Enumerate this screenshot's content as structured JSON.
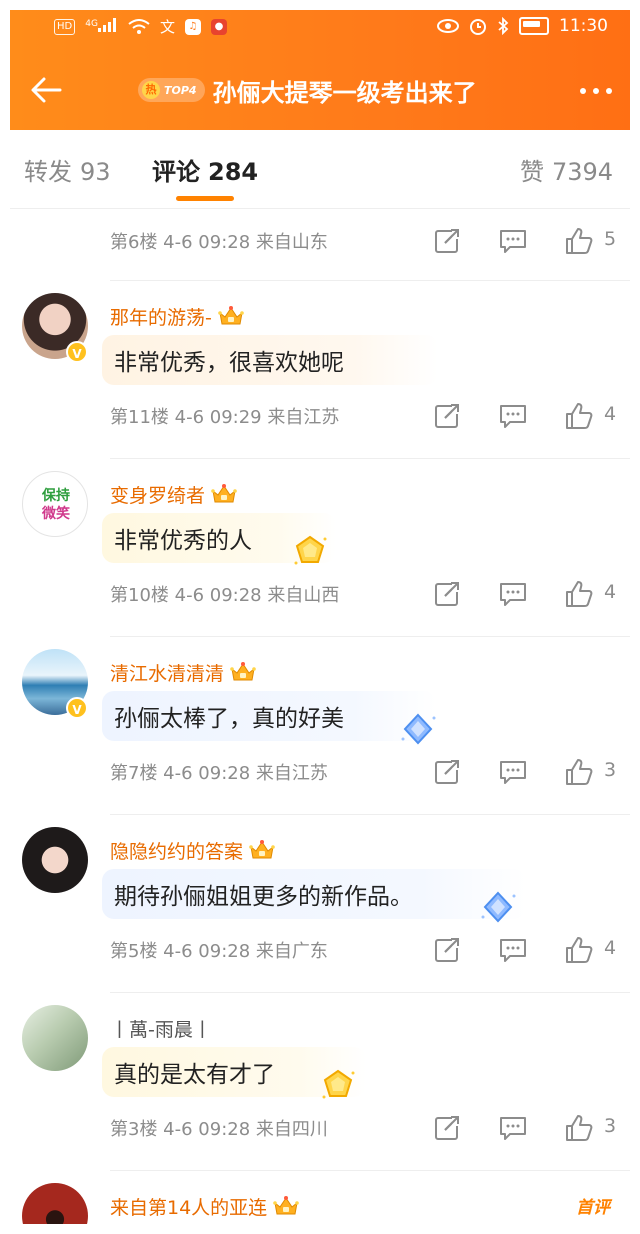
{
  "status_bar": {
    "hd": "HD",
    "net": "4G",
    "time": "11:30"
  },
  "header": {
    "hot_char": "热",
    "hot_rank": "TOP4",
    "title": "孙俪大提琴一级考出来了"
  },
  "tabs": [
    {
      "label": "转发",
      "count": "93"
    },
    {
      "label": "评论",
      "count": "284"
    },
    {
      "label": "赞",
      "count": "7394"
    }
  ],
  "first_row": {
    "meta": "第6楼 4-6 09:28 来自山东",
    "likes": "5"
  },
  "comments": [
    {
      "user": "那年的游荡-",
      "text": "非常优秀，很喜欢她呢",
      "meta": "第11楼 4-6 09:29 来自江苏",
      "likes": "4"
    },
    {
      "user": "变身罗绮者",
      "text": "非常优秀的人",
      "meta": "第10楼 4-6 09:28 来自山西",
      "likes": "4",
      "avatar_text": [
        "保持",
        "微笑"
      ]
    },
    {
      "user": "清江水清清清",
      "text": "孙俪太棒了，真的好美",
      "meta": "第7楼 4-6 09:28 来自江苏",
      "likes": "3"
    },
    {
      "user": "隐隐约约的答案",
      "text": "期待孙俪姐姐更多的新作品。",
      "meta": "第5楼 4-6 09:28 来自广东",
      "likes": "4"
    },
    {
      "user": "丨萬-雨晨丨",
      "text": "真的是太有才了",
      "meta": "第3楼 4-6 09:28 来自四川",
      "likes": "3"
    },
    {
      "user": "来自第14人的亚连",
      "tag": "首评"
    }
  ],
  "colors": {
    "brand": "#ff7a1a",
    "accent_orange": "#ff8200",
    "username": "#e86b00",
    "meta_gray": "#8c8c8c"
  }
}
